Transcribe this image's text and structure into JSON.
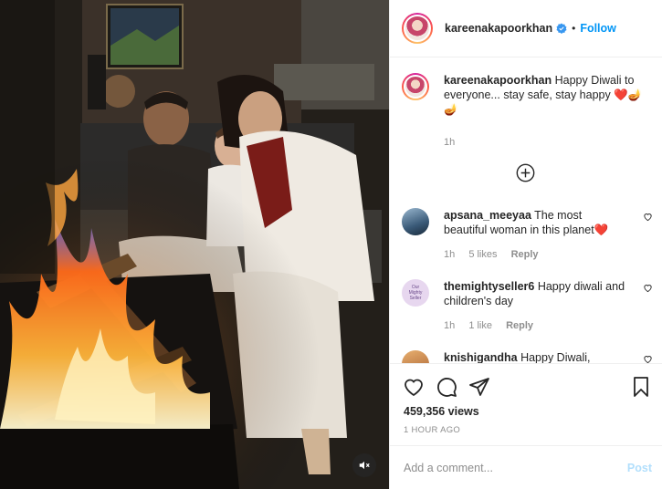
{
  "post": {
    "username": "kareenakapoorkhan",
    "follow_label": "Follow",
    "separator": "•",
    "caption": {
      "username": "kareenakapoorkhan",
      "text": "Happy Diwali to everyone... stay safe, stay happy",
      "emojis": "❤️🪔🪔",
      "time": "1h"
    },
    "comments": [
      {
        "username": "apsana_meeyaa",
        "text": "The most beautiful woman in this planet",
        "emoji": "❤️",
        "time": "1h",
        "likes": "5 likes",
        "reply": "Reply"
      },
      {
        "username": "themightyseller6",
        "text": "Happy diwali and children's day",
        "emoji": "",
        "time": "1h",
        "likes": "1 like",
        "reply": "Reply"
      },
      {
        "username": "knishigandha",
        "text": "Happy Diwali,",
        "emoji": "",
        "time": "",
        "likes": "",
        "reply": ""
      }
    ],
    "views": "459,356 views",
    "time_ago": "1 HOUR AGO",
    "add_comment_placeholder": "Add a comment...",
    "post_label": "Post",
    "avatar_badge_text": "Our Mighty Seller"
  },
  "colors": {
    "link_blue": "#0095f6",
    "muted": "#8e8e8e",
    "heart_red": "#ed4956",
    "post_disabled": "#b2dffc"
  }
}
